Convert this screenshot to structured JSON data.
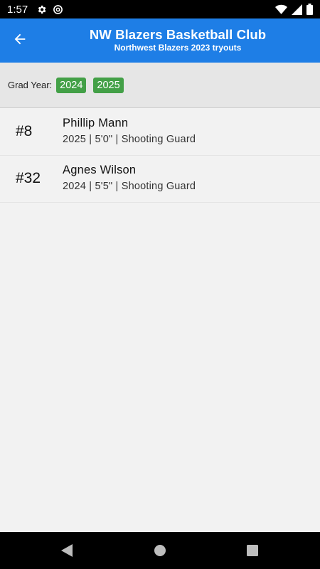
{
  "status_bar": {
    "time": "1:57",
    "icons": [
      "gear-icon",
      "circle-a-icon",
      "wifi-icon",
      "signal-icon",
      "battery-icon"
    ]
  },
  "app_bar": {
    "title": "NW Blazers Basketball Club",
    "subtitle": "Northwest Blazers 2023 tryouts",
    "color": "#1e7ee6",
    "back_icon": "arrow-back-icon"
  },
  "filter": {
    "label": "Grad Year:",
    "years": [
      "2024",
      "2025"
    ],
    "chip_color": "#43a047"
  },
  "players": [
    {
      "number": "#8",
      "name": "Phillip Mann",
      "details": "2025 | 5'0\" | Shooting Guard"
    },
    {
      "number": "#32",
      "name": "Agnes Wilson",
      "details": "2024 | 5'5\" | Shooting Guard"
    }
  ],
  "nav_bar": {
    "buttons": [
      "back-triangle-icon",
      "home-circle-icon",
      "recents-square-icon"
    ]
  }
}
